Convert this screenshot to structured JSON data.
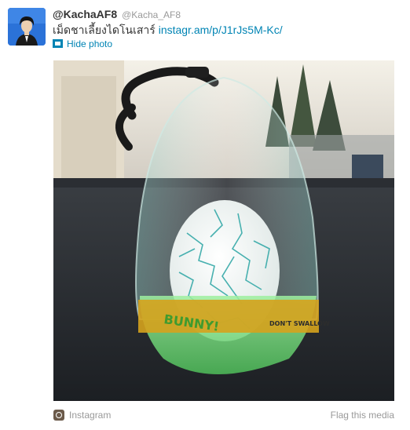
{
  "tweet": {
    "fullname": "@KachaAF8",
    "screen_name": "@Kacha_AF8",
    "text": "เม็ดชาเลี้ยงไดโนเสาร์",
    "link": "instagr.am/p/J1rJs5M-Kc/",
    "hide_photo": "Hide photo"
  },
  "media": {
    "egg_labels": [
      "BUNNY!",
      "DON'T SWALLOW"
    ]
  },
  "footer": {
    "source": "Instagram",
    "flag": "Flag this media"
  },
  "colors": {
    "link": "#0084b4",
    "muted": "#999999",
    "text": "#333333"
  }
}
